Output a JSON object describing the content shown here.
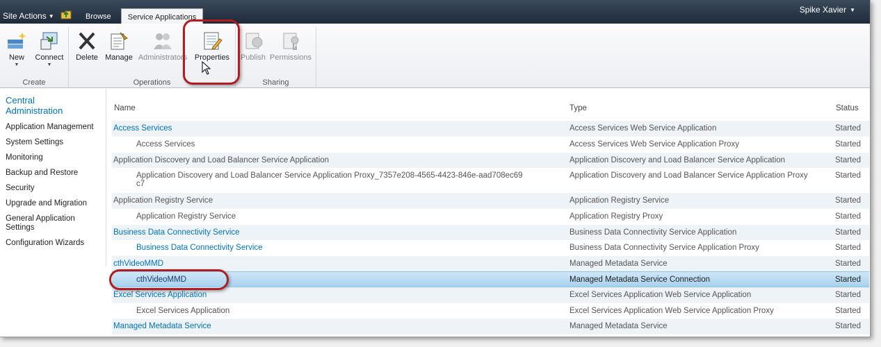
{
  "topbar": {
    "site_actions": "Site Actions",
    "tabs": [
      {
        "label": "Browse"
      },
      {
        "label": "Service Applications"
      }
    ],
    "user": "Spike Xavier"
  },
  "ribbon": {
    "groups": [
      {
        "label": "Create",
        "buttons": [
          {
            "label": "New"
          },
          {
            "label": "Connect"
          }
        ]
      },
      {
        "label": "Operations",
        "buttons": [
          {
            "label": "Delete"
          },
          {
            "label": "Manage"
          },
          {
            "label": "Administrators"
          },
          {
            "label": "Properties"
          }
        ]
      },
      {
        "label": "Sharing",
        "buttons": [
          {
            "label": "Publish"
          },
          {
            "label": "Permissions"
          }
        ]
      }
    ]
  },
  "leftnav": {
    "title": "Central Administration",
    "items": [
      "Application Management",
      "System Settings",
      "Monitoring",
      "Backup and Restore",
      "Security",
      "Upgrade and Migration",
      "General Application Settings",
      "Configuration Wizards"
    ]
  },
  "table": {
    "columns": {
      "name": "Name",
      "type": "Type",
      "status": "Status"
    },
    "rows": [
      {
        "name": "Access Services",
        "type": "Access Services Web Service Application",
        "status": "Started"
      },
      {
        "name": "Access Services",
        "type": "Access Services Web Service Application Proxy",
        "status": "Started"
      },
      {
        "name": "Application Discovery and Load Balancer Service Application",
        "type": "Application Discovery and Load Balancer Service Application",
        "status": "Started"
      },
      {
        "name": "Application Discovery and Load Balancer Service Application Proxy_7357e208-4565-4423-846e-aad708ec69c7",
        "type": "Application Discovery and Load Balancer Service Application Proxy",
        "status": "Started"
      },
      {
        "name": "Application Registry Service",
        "type": "Application Registry Service",
        "status": "Started"
      },
      {
        "name": "Application Registry Service",
        "type": "Application Registry Proxy",
        "status": "Started"
      },
      {
        "name": "Business Data Connectivity Service",
        "type": "Business Data Connectivity Service Application",
        "status": "Started"
      },
      {
        "name": "Business Data Connectivity Service",
        "type": "Business Data Connectivity Service Application Proxy",
        "status": "Started"
      },
      {
        "name": "cthVideoMMD",
        "type": "Managed Metadata Service",
        "status": "Started"
      },
      {
        "name": "cthVideoMMD",
        "type": "Managed Metadata Service Connection",
        "status": "Started"
      },
      {
        "name": "Excel Services Application",
        "type": "Excel Services Application Web Service Application",
        "status": "Started"
      },
      {
        "name": "Excel Services Application",
        "type": "Excel Services Application Web Service Application Proxy",
        "status": "Started"
      },
      {
        "name": "Managed Metadata Service",
        "type": "Managed Metadata Service",
        "status": "Started"
      }
    ]
  }
}
